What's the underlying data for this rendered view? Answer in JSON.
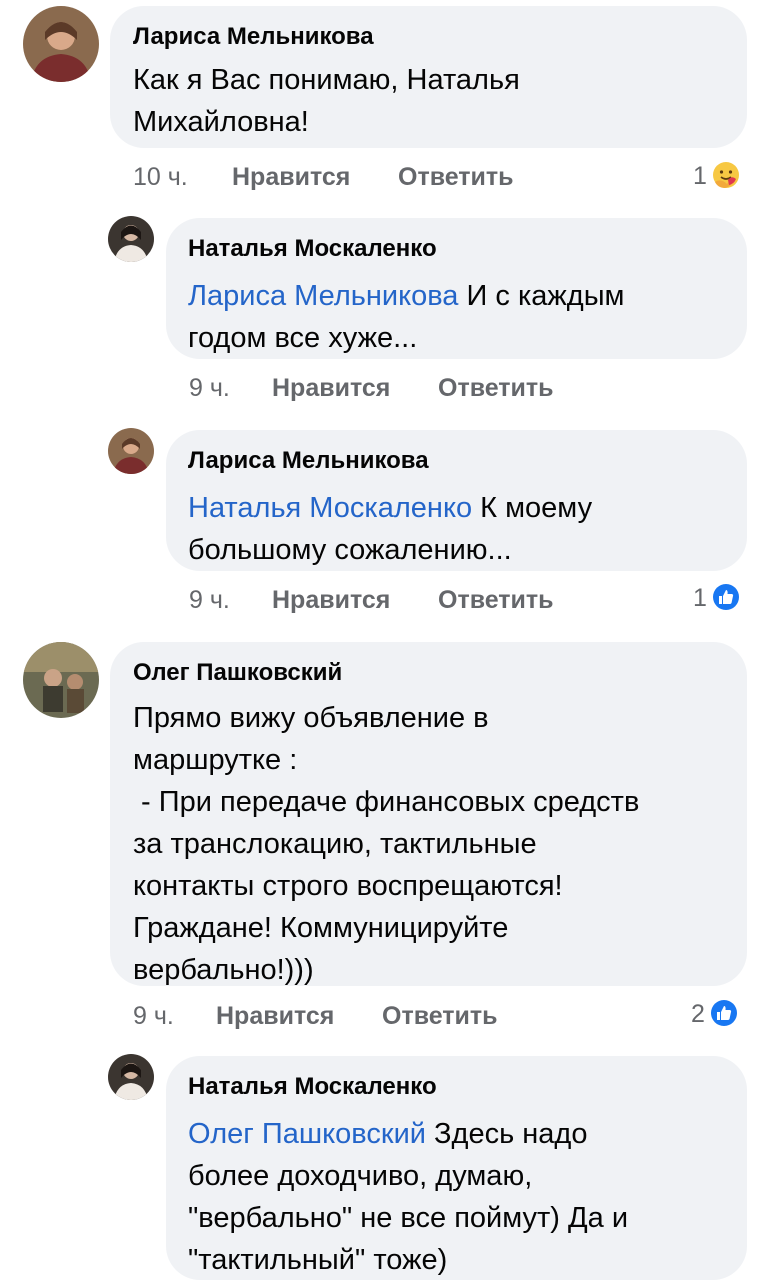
{
  "comments": [
    {
      "author": "Лариса Мельникова",
      "lines": [
        "Как я Вас понимаю,  Наталья",
        "Михайловна!"
      ],
      "time": "10 ч.",
      "like": "Нравится",
      "reply": "Ответить",
      "reactions": {
        "count": "1",
        "icon": "care-emoji-icon"
      }
    },
    {
      "author": "Наталья Москаленко",
      "mention": "Лариса Мельникова",
      "lines": [
        "И с каждым",
        "годом все хуже..."
      ],
      "time": "9 ч.",
      "like": "Нравится",
      "reply": "Ответить"
    },
    {
      "author": "Лариса Мельникова",
      "mention": "Наталья Москаленко",
      "lines": [
        "К моему",
        "большому сожалению..."
      ],
      "time": "9 ч.",
      "like": "Нравится",
      "reply": "Ответить",
      "reactions": {
        "count": "1",
        "icon": "like-icon"
      }
    },
    {
      "author": "Олег Пашковский",
      "lines": [
        "Прямо вижу объявление в",
        "маршрутке :",
        " - При передаче финансовых средств",
        "за транслокацию, тактильные",
        "контакты строго воспрещаются!",
        "Граждане! Коммуницируйте",
        "вербально!)))"
      ],
      "time": "9 ч.",
      "like": "Нравится",
      "reply": "Ответить",
      "reactions": {
        "count": "2",
        "icon": "like-icon"
      }
    },
    {
      "author": "Наталья Москаленко",
      "mention": "Олег Пашковский",
      "lines": [
        "Здесь надо",
        "более доходчиво, думаю,",
        "\"вербально\" не все поймут) Да и",
        "\"тактильный\" тоже)"
      ]
    }
  ],
  "colors": {
    "bubble": "#f0f2f5",
    "mention": "#2465c9",
    "meta": "#65676b",
    "like_blue": "#1877f2"
  }
}
